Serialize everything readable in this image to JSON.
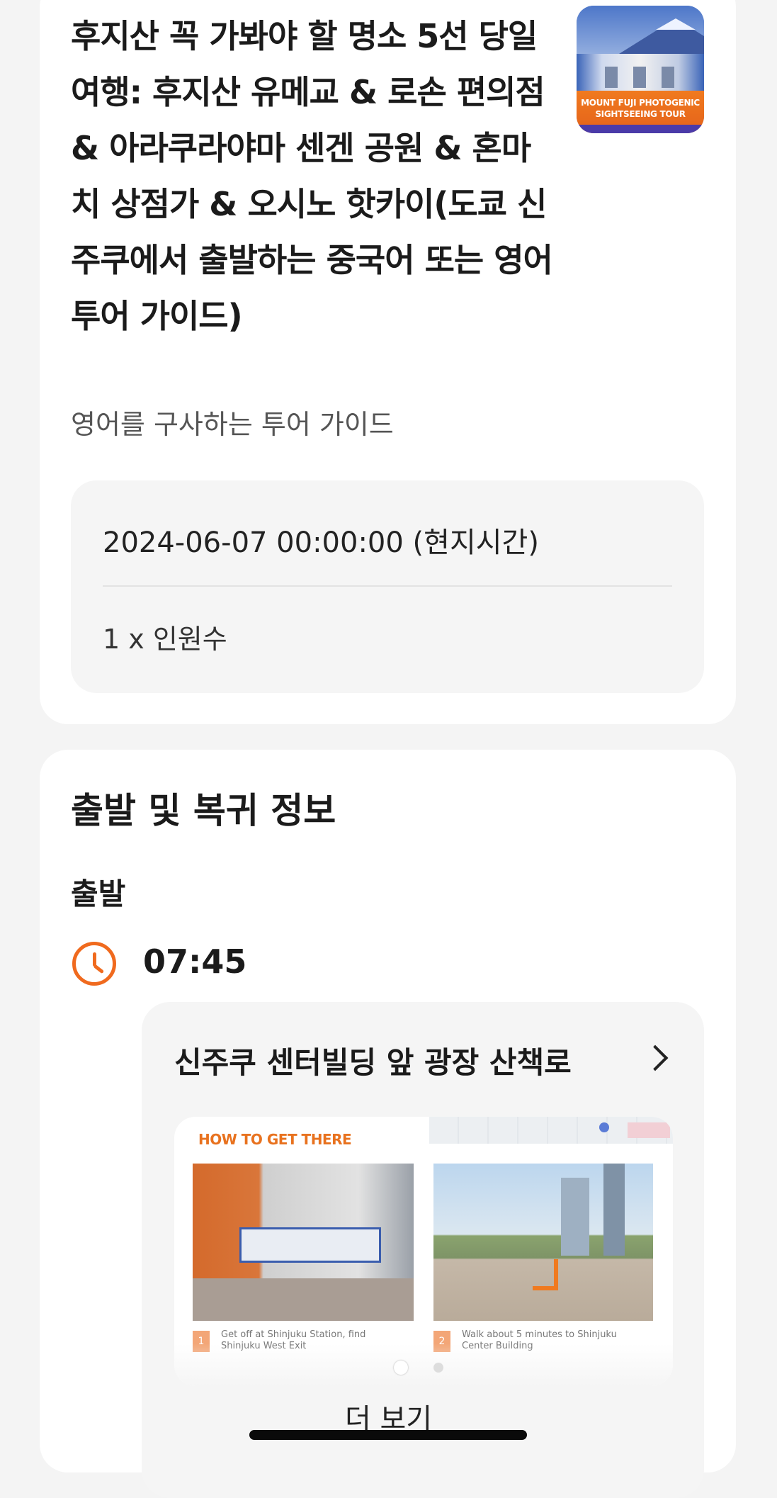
{
  "product": {
    "title": "후지산 꼭 가봐야 할 명소 5선 당일 여행: 후지산 유메교 & 로손 편의점 & 아라쿠라야마 센겐 공원 & 혼마치 상점가 & 오시노 핫카이(도쿄 신주쿠에서 출발하는 중국어 또는 영어 투어 가이드)",
    "thumbnail_text_line1": "MOUNT FUJI PHOTOGENIC",
    "thumbnail_text_line2": "SIGHTSEEING TOUR",
    "language_note": "영어를 구사하는 투어 가이드",
    "datetime": "2024-06-07 00:00:00 (현지시간)",
    "quantity": "1 x 인원수"
  },
  "departure_section": {
    "title": "출발 및 복귀 정보",
    "departure_label": "출발",
    "departure_time": "07:45",
    "location_name": "신주쿠 센터빌딩 앞 광장 산책로",
    "guide_image": {
      "header": "HOW TO GET THERE",
      "step1_number": "1",
      "step1_text": "Get off at Shinjuku Station, find Shinjuku West Exit",
      "step2_number": "2",
      "step2_text": "Walk about 5 minutes to Shinjuku Center Building"
    },
    "more_label": "더 보기"
  },
  "colors": {
    "accent": "#f06a1e",
    "page_bg": "#f4f4f4",
    "card_bg": "#ffffff",
    "box_bg": "#f5f5f5"
  }
}
